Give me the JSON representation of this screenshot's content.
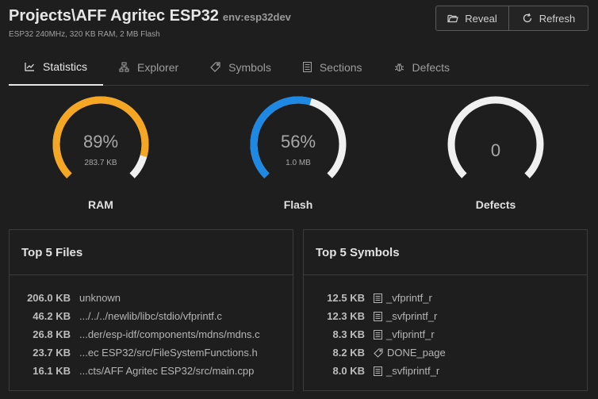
{
  "header": {
    "title": "Projects\\AFF Agritec ESP32",
    "env": "env:esp32dev",
    "subtitle": "ESP32 240MHz, 320 KB RAM, 2 MB Flash"
  },
  "actions": {
    "reveal_label": "Reveal",
    "refresh_label": "Refresh"
  },
  "tabs": [
    {
      "label": "Statistics",
      "icon": "chart-line-icon",
      "active": true
    },
    {
      "label": "Explorer",
      "icon": "hierarchy-icon",
      "active": false
    },
    {
      "label": "Symbols",
      "icon": "tag-icon",
      "active": false
    },
    {
      "label": "Sections",
      "icon": "list-icon",
      "active": false
    },
    {
      "label": "Defects",
      "icon": "bug-icon",
      "active": false
    }
  ],
  "gauges": {
    "ram": {
      "label": "RAM",
      "percent_text": "89%",
      "percent": 89,
      "sub": "283.7 KB",
      "color": "#f5a623"
    },
    "flash": {
      "label": "Flash",
      "percent_text": "56%",
      "percent": 56,
      "sub": "1.0 MB",
      "color": "#1e88e5"
    },
    "defects": {
      "label": "Defects",
      "value": "0",
      "percent": 0,
      "color": "#f0f0f0"
    }
  },
  "top_files": {
    "title": "Top 5 Files",
    "rows": [
      {
        "size": "206.0 KB",
        "name": "unknown"
      },
      {
        "size": "46.2 KB",
        "name": ".../../../newlib/libc/stdio/vfprintf.c"
      },
      {
        "size": "26.8 KB",
        "name": "...der/esp-idf/components/mdns/mdns.c"
      },
      {
        "size": "23.7 KB",
        "name": "...ec ESP32/src/FileSystemFunctions.h"
      },
      {
        "size": "16.1 KB",
        "name": "...cts/AFF Agritec ESP32/src/main.cpp"
      }
    ]
  },
  "top_symbols": {
    "title": "Top 5 Symbols",
    "rows": [
      {
        "size": "12.5 KB",
        "name": "_vfprintf_r",
        "icon": "function-icon"
      },
      {
        "size": "12.3 KB",
        "name": "_svfprintf_r",
        "icon": "function-icon"
      },
      {
        "size": "8.3 KB",
        "name": "_vfiprintf_r",
        "icon": "function-icon"
      },
      {
        "size": "8.2 KB",
        "name": "DONE_page",
        "icon": "tag-icon"
      },
      {
        "size": "8.0 KB",
        "name": "_svfiprintf_r",
        "icon": "function-icon"
      }
    ]
  }
}
